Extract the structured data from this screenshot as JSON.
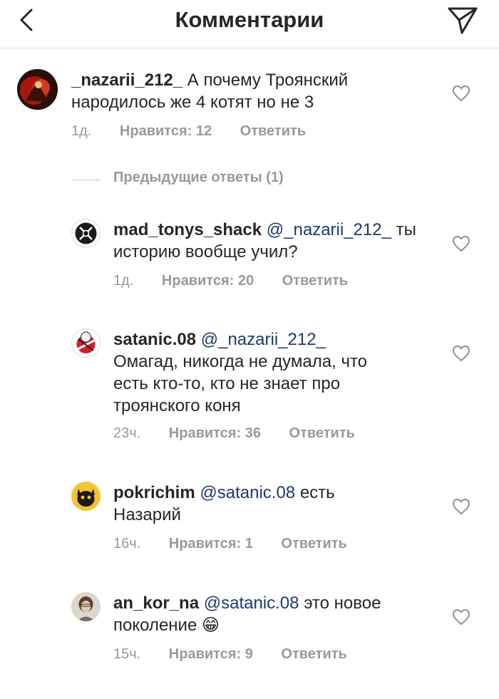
{
  "header": {
    "title": "Комментарии",
    "back_icon": "chevron-left-icon",
    "send_icon": "paper-plane-icon"
  },
  "main_comment": {
    "username": "_nazarii_212_",
    "text": "А почему Троянский народилось же 4 котят но не 3",
    "time": "1д.",
    "likes": "Нравится: 12",
    "reply": "Ответить"
  },
  "previous_replies": {
    "label": "Предыдущие ответы (1)"
  },
  "replies": [
    {
      "username": "mad_tonys_shack",
      "mention": "@_nazarii_212_",
      "text": "ты историю вообще учил?",
      "time": "1д.",
      "likes": "Нравится: 20",
      "reply": "Ответить"
    },
    {
      "username": "satanic.08",
      "mention": "@_nazarii_212_",
      "text": "Омагад, никогда не думала, что есть кто-то, кто не знает про троянского коня",
      "time": "23ч.",
      "likes": "Нравится: 36",
      "reply": "Ответить"
    },
    {
      "username": "pokrichim",
      "mention": "@satanic.08",
      "text": "есть Назарий",
      "time": "16ч.",
      "likes": "Нравится: 1",
      "reply": "Ответить"
    },
    {
      "username": "an_kor_na",
      "mention": "@satanic.08",
      "text": "это новое поколение",
      "emoji": "😁",
      "time": "15ч.",
      "likes": "Нравится: 9",
      "reply": "Ответить"
    }
  ],
  "colors": {
    "text": "#262626",
    "secondary": "#999999",
    "mention": "#1c3a6e",
    "divider": "#dbdbdb"
  }
}
